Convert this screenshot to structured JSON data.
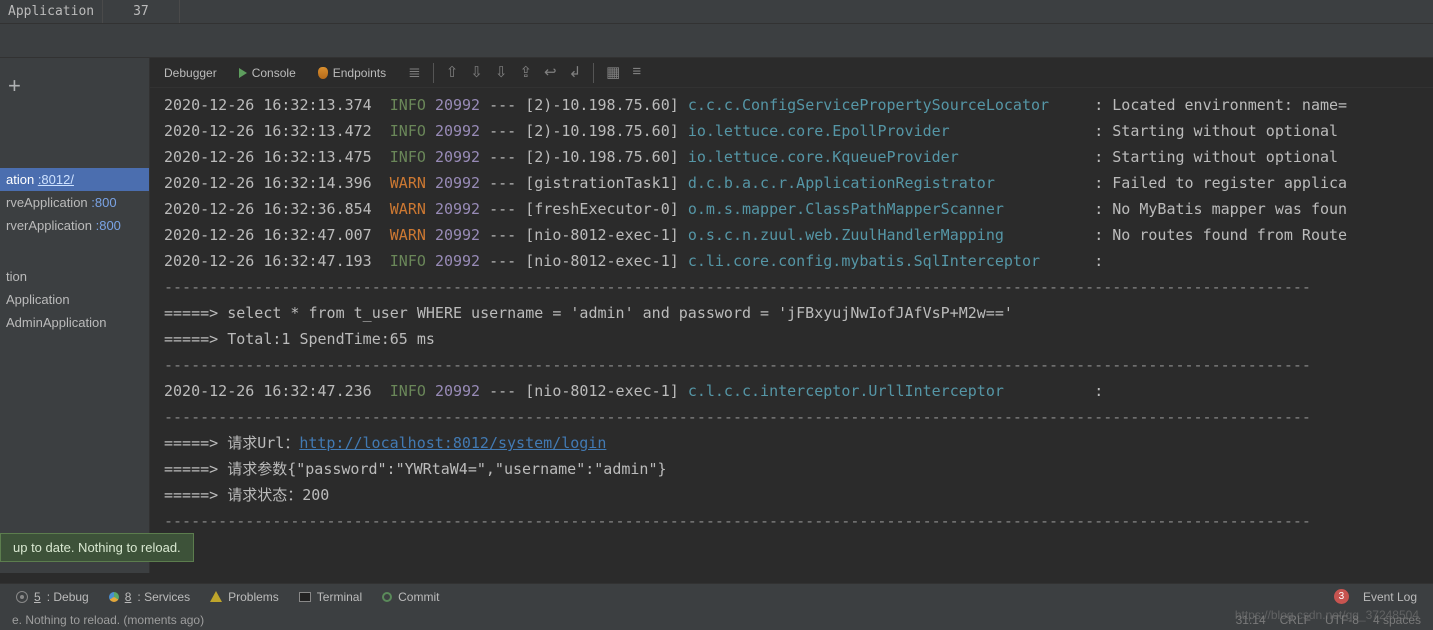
{
  "topbar": {
    "app_label": "Application",
    "line_number": "37"
  },
  "sidebar": {
    "items": [
      {
        "label": "ation ",
        "port": ":8012/",
        "selected": true
      },
      {
        "label": "rveApplication ",
        "port": ":800",
        "selected": false
      },
      {
        "label": "rverApplication ",
        "port": ":800",
        "selected": false
      }
    ],
    "lower": [
      "tion",
      "Application",
      "AdminApplication"
    ]
  },
  "debug_header": {
    "tabs": [
      "Debugger",
      "Console",
      "Endpoints"
    ]
  },
  "log_lines": [
    {
      "ts": "2020-12-26 16:32:13.374",
      "lv": "INFO",
      "pid": "20992",
      "thread": "[2)-10.198.75.60]",
      "logger": "c.c.c.ConfigServicePropertySourceLocator",
      "msg": ": Located environment: name="
    },
    {
      "ts": "2020-12-26 16:32:13.472",
      "lv": "INFO",
      "pid": "20992",
      "thread": "[2)-10.198.75.60]",
      "logger": "io.lettuce.core.EpollProvider",
      "msg": ": Starting without optional "
    },
    {
      "ts": "2020-12-26 16:32:13.475",
      "lv": "INFO",
      "pid": "20992",
      "thread": "[2)-10.198.75.60]",
      "logger": "io.lettuce.core.KqueueProvider",
      "msg": ": Starting without optional "
    },
    {
      "ts": "2020-12-26 16:32:14.396",
      "lv": "WARN",
      "pid": "20992",
      "thread": "[gistrationTask1]",
      "logger": "d.c.b.a.c.r.ApplicationRegistrator",
      "msg": ": Failed to register applica"
    },
    {
      "ts": "2020-12-26 16:32:36.854",
      "lv": "WARN",
      "pid": "20992",
      "thread": "[freshExecutor-0]",
      "logger": "o.m.s.mapper.ClassPathMapperScanner",
      "msg": ": No MyBatis mapper was foun"
    },
    {
      "ts": "2020-12-26 16:32:47.007",
      "lv": "WARN",
      "pid": "20992",
      "thread": "[nio-8012-exec-1]",
      "logger": "o.s.c.n.zuul.web.ZuulHandlerMapping",
      "msg": ": No routes found from Route"
    },
    {
      "ts": "2020-12-26 16:32:47.193",
      "lv": "INFO",
      "pid": "20992",
      "thread": "[nio-8012-exec-1]",
      "logger": "c.li.core.config.mybatis.SqlInterceptor",
      "msg": ":"
    }
  ],
  "sql_block": {
    "dash": "-------------------------------------------------------------------------------------------------------------------------------",
    "query": "=====> select * from t_user WHERE username = 'admin' and password = 'jFBxyujNwIofJAfVsP+M2w=='",
    "total": "=====> Total:1 SpendTime:65 ms"
  },
  "after_log": {
    "ts": "2020-12-26 16:32:47.236",
    "lv": "INFO",
    "pid": "20992",
    "thread": "[nio-8012-exec-1]",
    "logger": "c.l.c.c.interceptor.UrllInterceptor",
    "msg": ":"
  },
  "req_block": {
    "url_prefix": "=====> 请求Url：",
    "url": "http://localhost:8012/system/login",
    "params": "=====> 请求参数{\"password\":\"YWRtaW4=\",\"username\":\"admin\"}",
    "status": "=====> 请求状态：200"
  },
  "tooltip": "up to date. Nothing to reload.",
  "bottom_tabs": {
    "debug": "5: Debug",
    "services": "8: Services",
    "problems": "Problems",
    "terminal": "Terminal",
    "commit": "Commit",
    "event_badge": "3",
    "event_log": "Event Log"
  },
  "status": {
    "left": "e. Nothing to reload. (moments ago)",
    "cursor": "31:14",
    "le": "CRLF",
    "enc": "UTF-8",
    "indent": "4 spaces"
  },
  "watermark": "https://blog.csdn.net/qq_37248504"
}
